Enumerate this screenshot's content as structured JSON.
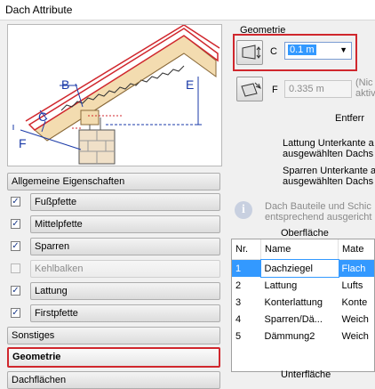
{
  "window": {
    "title": "Dach Attribute"
  },
  "diagram_labels": {
    "b": "B",
    "c": "C",
    "e": "E",
    "f": "F"
  },
  "sections": {
    "allgemeine": "Allgemeine Eigenschaften",
    "items": [
      {
        "label": "Fußpfette",
        "checked": true,
        "disabled": false
      },
      {
        "label": "Mittelpfette",
        "checked": true,
        "disabled": false
      },
      {
        "label": "Sparren",
        "checked": true,
        "disabled": false
      },
      {
        "label": "Kehlbalken",
        "checked": false,
        "disabled": true
      },
      {
        "label": "Lattung",
        "checked": true,
        "disabled": false
      },
      {
        "label": "Firstpfette",
        "checked": true,
        "disabled": false
      }
    ],
    "sonstiges": "Sonstiges",
    "geometrie": "Geometrie",
    "dachflaechen": "Dachflächen"
  },
  "geometry": {
    "heading": "Geometrie",
    "c_label": "C",
    "c_value": "0.1 m",
    "f_label": "F",
    "f_value": "0.335 m",
    "f_note_1": "(Nic",
    "f_note_2": "aktiv",
    "entfernung": "Entferr",
    "lattung_1": "Lattung Unterkante a",
    "lattung_2": "ausgewählten Dachs",
    "sparren_1": "Sparren Unterkante a",
    "sparren_2": "ausgewählten Dachs",
    "info_1": "Dach Bauteile und Schic",
    "info_2": "entsprechend ausgericht"
  },
  "oberflaeche": {
    "title": "Oberfläche",
    "columns": [
      "Nr.",
      "Name",
      "Mate"
    ],
    "rows": [
      {
        "nr": "1",
        "name": "Dachziegel",
        "mat": "Flach"
      },
      {
        "nr": "2",
        "name": "Lattung",
        "mat": "Lufts"
      },
      {
        "nr": "3",
        "name": "Konterlattung",
        "mat": "Konte"
      },
      {
        "nr": "4",
        "name": "Sparren/Dä...",
        "mat": "Weich"
      },
      {
        "nr": "5",
        "name": "Dämmung2",
        "mat": "Weich"
      }
    ]
  },
  "unterflaeche": {
    "title": "Unterfläche"
  }
}
